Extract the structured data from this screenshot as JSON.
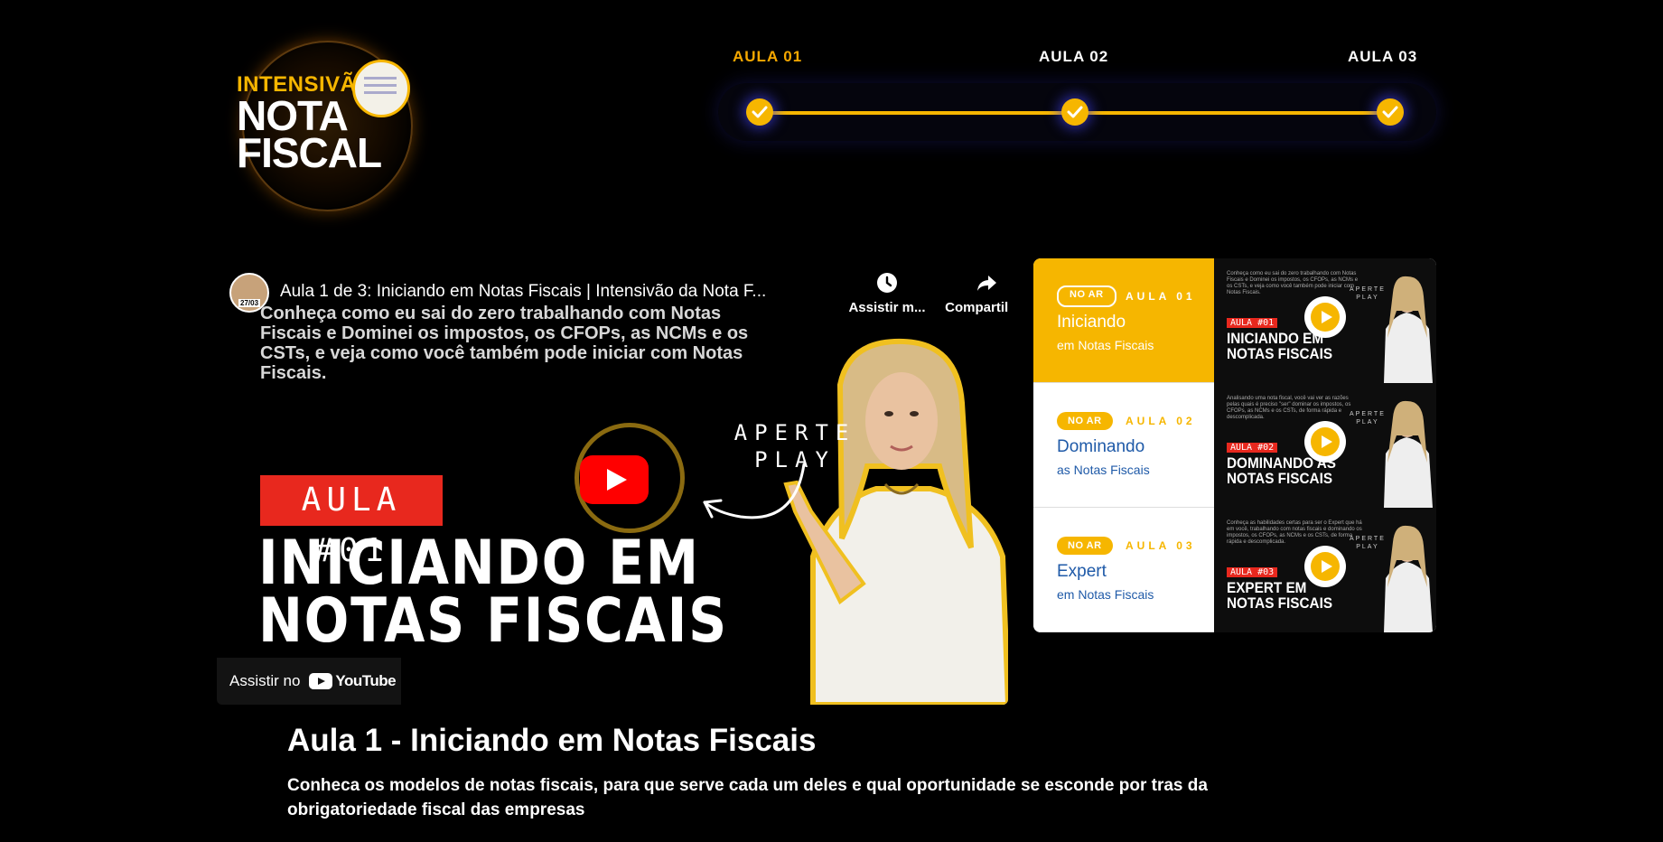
{
  "logo": {
    "line1": "INTENSIVÃ",
    "line2": "NOTA",
    "line3": "FISCAL"
  },
  "progress": {
    "steps": [
      {
        "label": "AULA 01",
        "completed": true
      },
      {
        "label": "AULA 02",
        "completed": true
      },
      {
        "label": "AULA 03",
        "completed": true
      }
    ],
    "accent_color": "#f6b600"
  },
  "video": {
    "avatar_badge": "27/03",
    "title": "Aula 1 de 3: Iniciando em Notas Fiscais | Intensivão da Nota F...",
    "description": "Conheça como eu sai do zero trabalhando com Notas Fiscais e Dominei os impostos, os CFOPs, as NCMs e os CSTs, e veja como você também pode iniciar com Notas Fiscais.",
    "watch_later_label": "Assistir m...",
    "share_label": "Compartilh...",
    "thumbnail_tag": "AULA #01",
    "thumbnail_title_line1": "INICIANDO EM",
    "thumbnail_title_line2": "NOTAS FISCAIS",
    "aperte_line1": "APERTE",
    "aperte_line2": "PLAY",
    "watch_on_label": "Assistir no",
    "youtube_label": "YouTube"
  },
  "playlist": {
    "items": [
      {
        "status": "NO AR",
        "number": "AULA 01",
        "title": "Iniciando",
        "subtitle": "em Notas Fiscais",
        "active": true,
        "thumb_desc": "Conheça como eu sai do zero trabalhando com Notas Fiscais e Dominei os impostos, os CFOPs, as NCMs e os CSTs, e veja como você também pode iniciar com Notas Fiscais.",
        "thumb_tag": "AULA #01",
        "thumb_title1": "INICIANDO EM",
        "thumb_title2": "NOTAS FISCAIS"
      },
      {
        "status": "NO AR",
        "number": "AULA 02",
        "title": "Dominando",
        "subtitle": "as Notas Fiscais",
        "active": false,
        "thumb_desc": "Analisando uma nota fiscal, você vai ver as razões pelas quais é preciso \"ser\" dominar os impostos, os CFOPs, as NCMs e os CSTs, de forma rápida e descomplicada.",
        "thumb_tag": "AULA #02",
        "thumb_title1": "DOMINANDO AS",
        "thumb_title2": "NOTAS FISCAIS"
      },
      {
        "status": "NO AR",
        "number": "AULA 03",
        "title": "Expert",
        "subtitle": "em Notas Fiscais",
        "active": false,
        "thumb_desc": "Conheça as habilidades certas para ser o Expert que há em você, trabalhando com notas fiscais e dominando os impostos, os CFOPs, as NCMs e os CSTs, de forma rápida e descomplicada.",
        "thumb_tag": "AULA #03",
        "thumb_title1": "EXPERT EM",
        "thumb_title2": "NOTAS FISCAIS"
      }
    ],
    "thumb_aperte1": "APERTE",
    "thumb_aperte2": "PLAY"
  },
  "lesson": {
    "title": "Aula 1 - Iniciando em Notas Fiscais",
    "description": "Conheca os modelos de notas fiscais, para que serve cada um deles e qual oportunidade se esconde por tras da obrigatoriedade fiscal das empresas"
  }
}
